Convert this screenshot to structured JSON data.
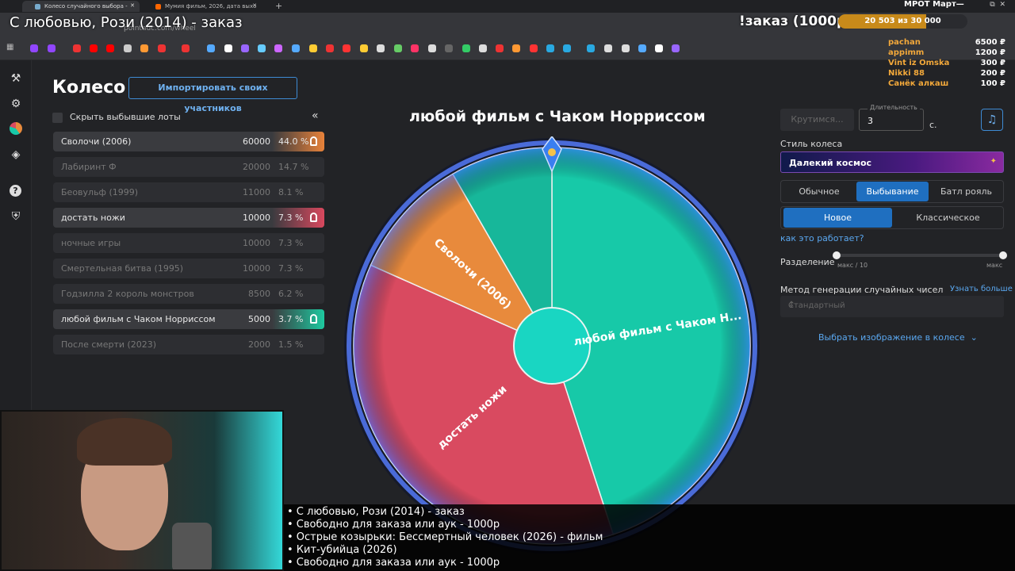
{
  "browser": {
    "tabs": [
      {
        "title": "Колесо случайного выбора - ",
        "active": true
      },
      {
        "title": "Мумия фильм, 2026, дата выхо",
        "active": false
      }
    ],
    "url": "pointauc.com/wheel",
    "new_tab": "+"
  },
  "overlay": {
    "now_playing": "С любовью, Рози (2014) - заказ",
    "order_label": "!заказ (1000р)",
    "goal_text": "20 503  из 30 000",
    "goal_fraction": 0.68,
    "mrot": "МРОТ Март—",
    "donors": [
      {
        "name": "pachan",
        "amount": "6500 ₽"
      },
      {
        "name": "appimm",
        "amount": "1200 ₽"
      },
      {
        "name": "Vint iz Omska",
        "amount": "300 ₽"
      },
      {
        "name": "Nikki 88",
        "amount": "200 ₽"
      },
      {
        "name": "Санёк алкаш",
        "amount": "100 ₽"
      }
    ],
    "queue": [
      "• С любовью, Рози (2014) - заказ",
      "• Свободно для заказа или аук - 1000р",
      "• Острые козырьки: Бессмертный человек (2026) - фильм",
      "• Кит-убийца (2026)",
      "• Свободно для заказа или аук - 1000р"
    ]
  },
  "page": {
    "title": "Колесо",
    "import_button": "Импортировать своих участников",
    "hide_checkbox": "Скрыть выбывшие лоты",
    "collapse": "«"
  },
  "lots": [
    {
      "name": "Сволочи (2006)",
      "amount": "60000",
      "percent": "44.0 %",
      "out": false,
      "color": "#e8823a"
    },
    {
      "name": "Лабиринт Ф",
      "amount": "20000",
      "percent": "14.7 %",
      "out": true
    },
    {
      "name": "Беовульф (1999)",
      "amount": "11000",
      "percent": "8.1 %",
      "out": true
    },
    {
      "name": "достать ножи",
      "amount": "10000",
      "percent": "7.3 %",
      "out": false,
      "color": "#d9485e"
    },
    {
      "name": "ночные игры",
      "amount": "10000",
      "percent": "7.3 %",
      "out": true
    },
    {
      "name": "Смертельная битва (1995)",
      "amount": "10000",
      "percent": "7.3 %",
      "out": true
    },
    {
      "name": "Годзилла 2 король монстров",
      "amount": "8500",
      "percent": "6.2 %",
      "out": true
    },
    {
      "name": "любой фильм с Чаком Норриссом",
      "amount": "5000",
      "percent": "3.7 %",
      "out": false,
      "color": "#1ec9a0"
    },
    {
      "name": "После смерти (2023)",
      "amount": "2000",
      "percent": "1.5 %",
      "out": true
    }
  ],
  "wheel": {
    "winner_title": "любой фильм с Чаком Норриссом",
    "segments": [
      {
        "label": "любой фильм с Чаком Н...",
        "start": 0,
        "end": 162,
        "color": "#17c9a8"
      },
      {
        "label": "достать ножи",
        "start": 162,
        "end": 294,
        "color": "#d94a60"
      },
      {
        "label": "Сволочи (2006)",
        "start": 294,
        "end": 330,
        "color": "#e88a3c"
      },
      {
        "label": "",
        "start": 330,
        "end": 360,
        "color": "#17b79a"
      }
    ]
  },
  "controls": {
    "spin_button": "Крутимся...",
    "duration_label": "Длительность",
    "duration_value": "3",
    "seconds": "с.",
    "style_label": "Стиль колеса",
    "style_value": "Далекий космос",
    "modes": [
      "Обычное",
      "Выбывание",
      "Батл рояль"
    ],
    "mode_selected": 1,
    "variants": [
      "Новое",
      "Классическое"
    ],
    "variant_selected": 0,
    "how_link": "как это работает?",
    "split_label": "Разделение",
    "split_min": "макс / 10",
    "split_max": "макс",
    "rng_label": "Метод генерации случайных чисел",
    "rng_link": "Узнать больше",
    "rng_value": "Стандартный",
    "image_link": "Выбрать изображение в колесе"
  }
}
